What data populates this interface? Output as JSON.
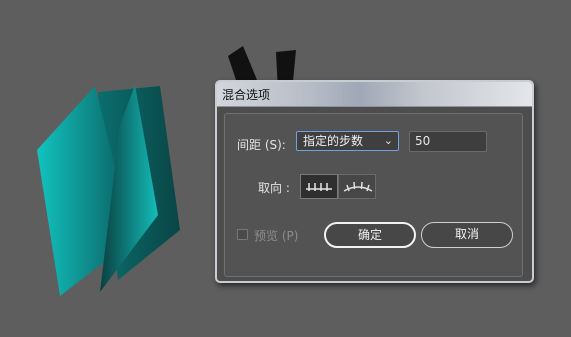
{
  "dialog": {
    "title": "混合选项",
    "spacing": {
      "label": "间距 (S):",
      "selected_option": "指定的步数",
      "value": "50"
    },
    "orientation": {
      "label": "取向 :",
      "options": [
        "align-to-page-icon",
        "align-to-path-icon"
      ],
      "selected": 0
    },
    "preview": {
      "label": "预览 (P)",
      "checked": false
    },
    "buttons": {
      "ok": "确定",
      "cancel": "取消"
    }
  },
  "colors": {
    "canvas_bg": "#5e5e5e",
    "shape_teal": "#0fb3b0",
    "shape_dark_teal": "#0b4b4d",
    "shape_black": "#111111",
    "focus_blue": "#6fa2e2"
  }
}
